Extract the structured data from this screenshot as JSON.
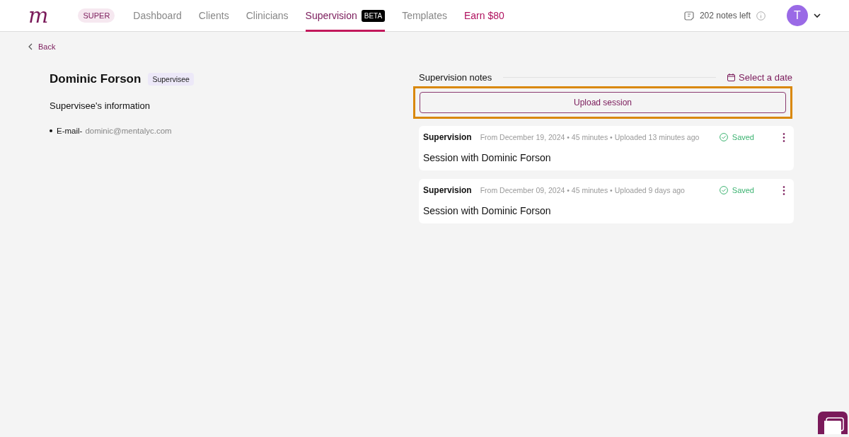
{
  "header": {
    "logo": "m",
    "plan_badge": "SUPER",
    "nav": [
      {
        "label": "Dashboard",
        "selected": false,
        "kind": "plain"
      },
      {
        "label": "Clients",
        "selected": false,
        "kind": "plain"
      },
      {
        "label": "Clinicians",
        "selected": false,
        "kind": "plain"
      },
      {
        "label": "Supervision",
        "selected": true,
        "kind": "plain",
        "badge": "BETA"
      },
      {
        "label": "Templates",
        "selected": false,
        "kind": "plain"
      },
      {
        "label": "Earn $80",
        "selected": false,
        "kind": "promo"
      }
    ],
    "notes_left": "202 notes left",
    "avatar": "T"
  },
  "back": "Back",
  "supervisee": {
    "name": "Dominic Forson",
    "role_badge": "Supervisee",
    "section_title": "Supervisee's information",
    "fields": [
      {
        "label": "E-mail-",
        "value": "dominic@mentalyc.com"
      }
    ]
  },
  "notes": {
    "title": "Supervision notes",
    "date_picker": "Select a date",
    "upload_button": "Upload session",
    "upload_highlighted": true,
    "items": [
      {
        "type": "Supervision",
        "meta": "From December 19, 2024 • 45 minutes • Uploaded 13 minutes ago",
        "status": "Saved",
        "saved": true,
        "title": "Session with Dominic Forson"
      },
      {
        "type": "Supervision",
        "meta": "From December 09, 2024 • 45 minutes • Uploaded 9 days ago",
        "status": "Saved",
        "saved": true,
        "title": "Session with Dominic Forson"
      }
    ]
  }
}
